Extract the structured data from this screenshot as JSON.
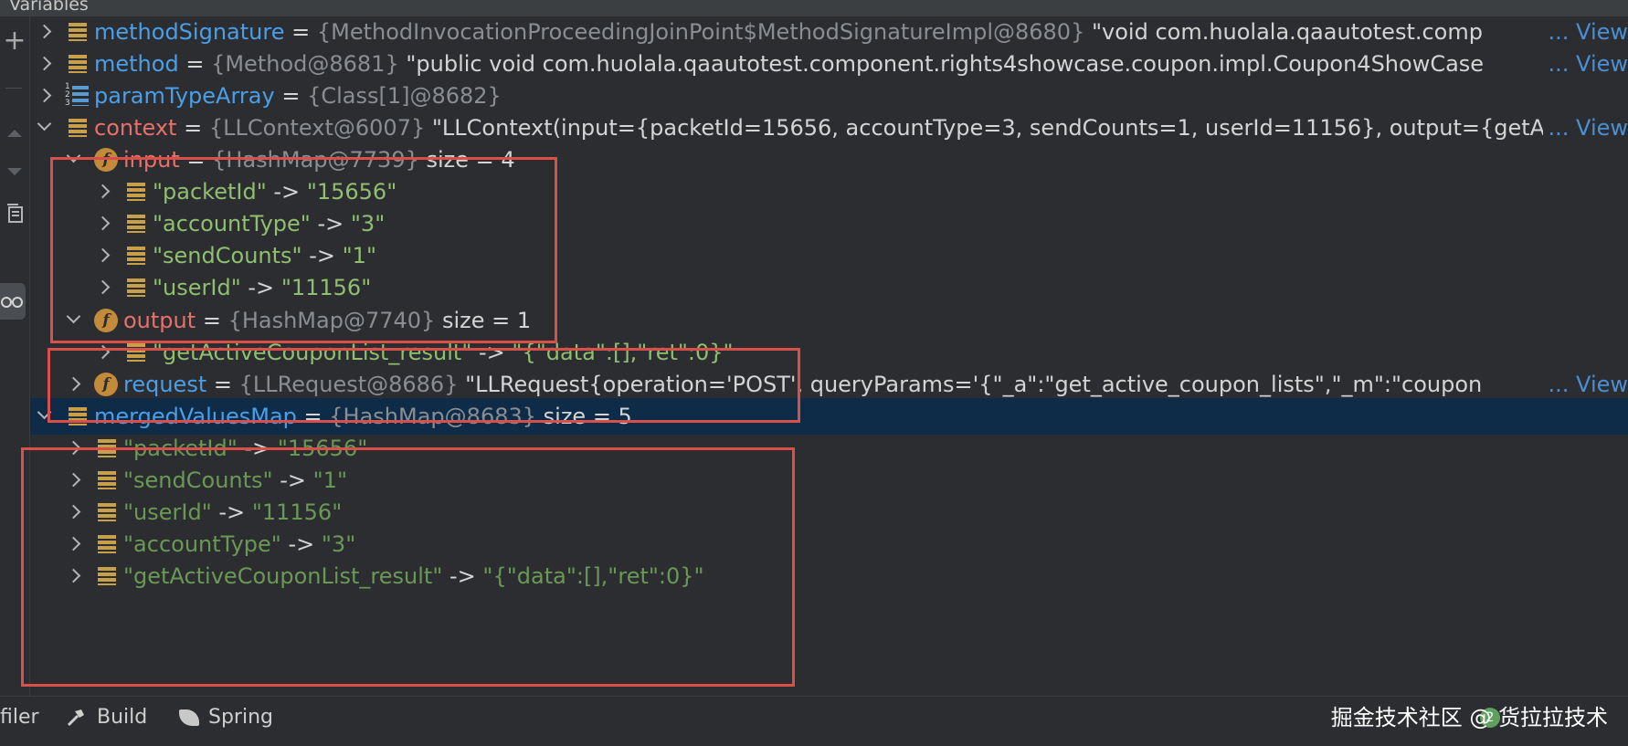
{
  "panel": {
    "title": "Variables"
  },
  "rows": [
    {
      "name": "methodSignature",
      "ref": "{MethodInvocationProceedingJoinPoint$MethodSignatureImpl@8680}",
      "value": "\"void com.huolala.qaautotest.comp",
      "view": "... View"
    },
    {
      "name": "method",
      "ref": "{Method@8681}",
      "value": "\"public void com.huolala.qaautotest.component.rights4showcase.coupon.impl.Coupon4ShowCase",
      "view": "... View"
    },
    {
      "name": "paramTypeArray",
      "ref": "{Class[1]@8682}"
    },
    {
      "name": "context",
      "ref": "{LLContext@6007}",
      "value": "\"LLContext(input={packetId=15656, accountType=3, sendCounts=1, userId=11156}, output={getA",
      "view": "... View"
    },
    {
      "name": "input",
      "ref": "{HashMap@7739}",
      "size": "size = 4"
    },
    {
      "key": "\"packetId\"",
      "val": "\"15656\""
    },
    {
      "key": "\"accountType\"",
      "val": "\"3\""
    },
    {
      "key": "\"sendCounts\"",
      "val": "\"1\""
    },
    {
      "key": "\"userId\"",
      "val": "\"11156\""
    },
    {
      "name": "output",
      "ref": "{HashMap@7740}",
      "size": "size = 1"
    },
    {
      "key": "\"getActiveCouponList_result\"",
      "val": "\"{\"data\":[],\"ret\":0}\""
    },
    {
      "name": "request",
      "ref": "{LLRequest@8686}",
      "value": "\"LLRequest{operation='POST', queryParams='{\"_a\":\"get_active_coupon_lists\",\"_m\":\"coupon",
      "view": "... View"
    },
    {
      "name": "mergedValuesMap",
      "ref": "{HashMap@8683}",
      "size": "size = 5"
    },
    {
      "key": "\"packetId\"",
      "val": "\"15656\""
    },
    {
      "key": "\"sendCounts\"",
      "val": "\"1\""
    },
    {
      "key": "\"userId\"",
      "val": "\"11156\""
    },
    {
      "key": "\"accountType\"",
      "val": "\"3\""
    },
    {
      "key": "\"getActiveCouponList_result\"",
      "val": "\"{\"data\":[],\"ret\":0}\""
    }
  ],
  "common": {
    "eq": "=",
    "arrow": "->"
  },
  "sidebar": {
    "add_glyph": "+"
  },
  "bottom_bar": {
    "profiler": "filer",
    "build": "Build",
    "spring": "Spring",
    "badge": "2",
    "watermark": "掘金技术社区 @ 货拉拉技术"
  },
  "colors": {
    "accent": "#4a9fe8",
    "highlight_box": "#d9504a",
    "selection": "#0e2c48"
  },
  "icons": [
    "field-icon",
    "map-entry-icon",
    "array-icon",
    "expand-chevron-icon",
    "hammer-icon",
    "spring-leaf-icon"
  ]
}
